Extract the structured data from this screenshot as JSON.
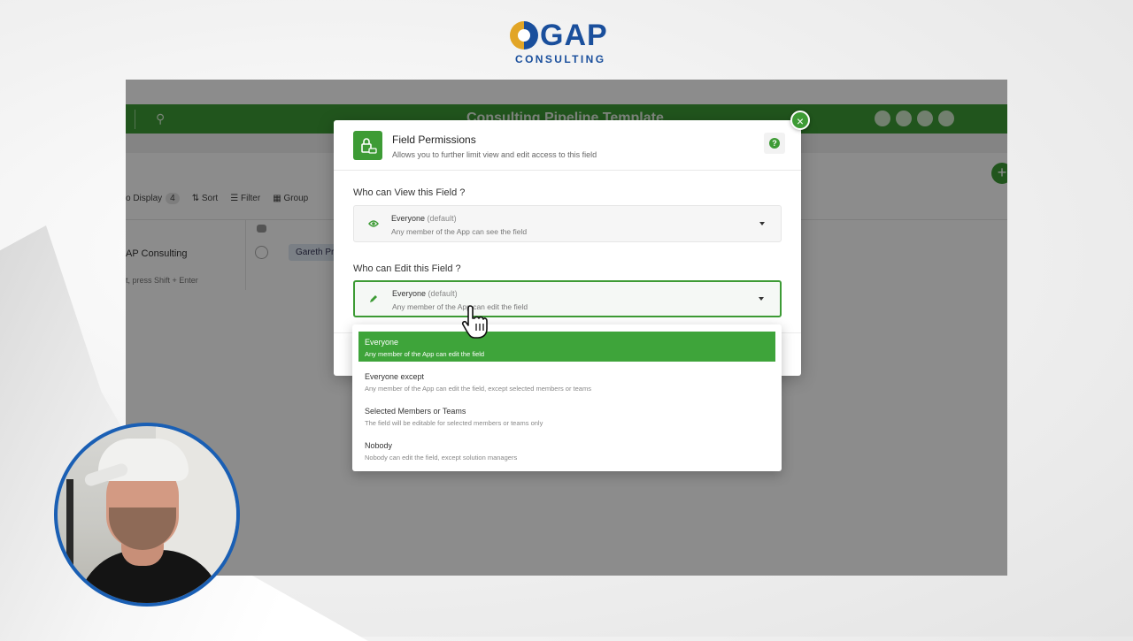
{
  "brand": {
    "logo_word": "GAP",
    "logo_sub": "CONSULTING"
  },
  "app_background": {
    "title": "Consulting Pipeline Template",
    "toolbar": {
      "display_label": "o Display",
      "display_count": "4",
      "sort_label": "Sort",
      "filter_label": "Filter",
      "group_label": "Group"
    },
    "row_name": "AP Consulting",
    "row_hint": "t, press Shift + Enter",
    "member_pill": "Gareth Pr"
  },
  "modal": {
    "title": "Field Permissions",
    "subtitle": "Allows you to further limit view and edit access to this field",
    "help_label": "?",
    "close_label": "×",
    "view_section": {
      "label": "Who can View this Field ?",
      "selected": "Everyone",
      "selected_tag": "(default)",
      "description": "Any member of the App can see the field"
    },
    "edit_section": {
      "label": "Who can Edit this Field ?",
      "selected": "Everyone",
      "selected_tag": "(default)",
      "description": "Any member of the App can edit the field"
    }
  },
  "dropdown": {
    "options": [
      {
        "label": "Everyone",
        "description": "Any member of the App can edit the field",
        "selected": true
      },
      {
        "label": "Everyone except",
        "description": "Any member of the App can edit the field, except selected members or teams",
        "selected": false
      },
      {
        "label": "Selected Members or Teams",
        "description": "The field will be editable for selected members or teams only",
        "selected": false
      },
      {
        "label": "Nobody",
        "description": "Nobody can edit the field, except solution managers",
        "selected": false
      }
    ]
  },
  "colors": {
    "accent_green": "#3d9b35",
    "brand_blue": "#1a4f9c",
    "brand_gold": "#e2a526",
    "webcam_ring": "#1a5fb4"
  }
}
